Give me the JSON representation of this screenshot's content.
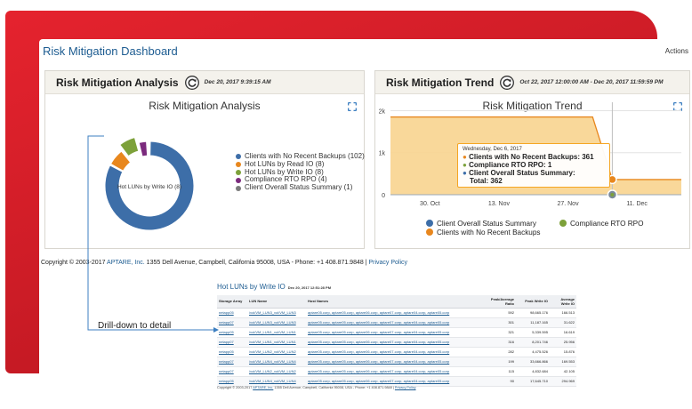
{
  "header": {
    "title": "Risk Mitigation Dashboard",
    "actions": "Actions"
  },
  "analysis_panel": {
    "title": "Risk Mitigation Analysis",
    "date": "Dec 20, 2017 9:39:15 AM",
    "chart_title": "Risk Mitigation Analysis",
    "donut_label": "Hot LUNs by Write IO (8)",
    "expand_icon": "expand-icon",
    "refresh_icon": "refresh-icon"
  },
  "trend_panel": {
    "title": "Risk Mitigation Trend",
    "date": "Oct 22, 2017 12:00:00 AM - Dec 20, 2017 11:59:59 PM",
    "chart_title": "Risk Mitigation Trend",
    "tooltip": {
      "date": "Wednesday, Dec 6, 2017",
      "row1": "Clients with No Recent Backups: 361",
      "row2": "Compliance RTO RPO: 1",
      "row3": "Client Overall Status Summary:",
      "row4": "Total: 362"
    }
  },
  "chart_data": [
    {
      "type": "pie",
      "title": "Risk Mitigation Analysis",
      "labels": [
        "Clients with No Recent Backups",
        "Hot LUNs by Read IO",
        "Hot LUNs by Write IO",
        "Compliance RTO RPO",
        "Client Overall Status Summary"
      ],
      "legend": [
        "Clients with No Recent Backups (102)",
        "Hot LUNs by Read IO (8)",
        "Hot LUNs by Write IO (8)",
        "Compliance RTO RPO (4)",
        "Client Overall Status Summary (1)"
      ],
      "values": [
        102,
        8,
        8,
        4,
        1
      ],
      "colors": [
        "#3d6ea8",
        "#e8871e",
        "#7da13a",
        "#7b2a7d",
        "#7b7b7b"
      ],
      "legend_placement": "right"
    },
    {
      "type": "area",
      "title": "Risk Mitigation Trend",
      "x_ticks": [
        "30. Oct",
        "13. Nov",
        "27. Nov",
        "11. Dec"
      ],
      "y_ticks": [
        "0",
        "1k",
        "2k"
      ],
      "ylim": [
        0,
        2200
      ],
      "x": [
        "2017-10-22",
        "2017-10-30",
        "2017-11-13",
        "2017-11-27",
        "2017-12-02",
        "2017-12-06",
        "2017-12-11",
        "2017-12-20"
      ],
      "series": [
        {
          "name": "Client Overall Status Summary",
          "color": "#3d6ea8",
          "values": [
            null,
            null,
            null,
            null,
            null,
            null,
            null,
            null
          ]
        },
        {
          "name": "Compliance RTO RPO",
          "color": "#7da13a",
          "values": [
            1,
            1,
            1,
            1,
            1,
            1,
            1,
            1
          ]
        },
        {
          "name": "Clients with No Recent Backups",
          "color": "#e8871e",
          "values": [
            1850,
            1850,
            1850,
            1850,
            1850,
            361,
            361,
            361
          ]
        }
      ],
      "grid": true,
      "legend_placement": "bottom"
    }
  ],
  "footer": {
    "prefix": "Copyright © 2003-2017",
    "company": "APTARE, Inc.",
    "address": "1355 Dell Avenue, Campbell, California 95008, USA - Phone: +1 408.871.9848 |",
    "privacy": "Privacy Policy"
  },
  "drilldown": {
    "label": "Drill-down to detail",
    "title": "Hot LUNs by Write IO",
    "date": "Dec 20, 2017 12:51:28 PM",
    "columns": [
      "Storage Array",
      "LUN Name",
      "Host Names",
      "Peak/Average Ratio",
      "Peak Write IO",
      "Average Write IO"
    ],
    "hosts": "aptare05.corp, aptare05.corp, aptare06.corp, aptare07.corp, aptare04.corp, aptare05.corp",
    "rows": [
      {
        "array": "netapp05",
        "lun": "/vol/VM_LUN3_vol/VM_LUN3",
        "ratio": "592",
        "peak": "98,665.176",
        "avg": "166.513"
      },
      {
        "array": "netapp07",
        "lun": "/vol/VM_LUN3_vol/VM_LUN3",
        "ratio": "301",
        "peak": "11,187.165",
        "avg": "31.622"
      },
      {
        "array": "netapp05",
        "lun": "/vol/VM_LUN1_vol/VM_LUN1",
        "ratio": "321",
        "peak": "5,339.595",
        "avg": "16.619"
      },
      {
        "array": "netapp07",
        "lun": "/vol/VM_LUN1_vol/VM_LUN1",
        "ratio": "316",
        "peak": "8,201.746",
        "avg": "25.956"
      },
      {
        "array": "netapp05",
        "lun": "/vol/VM_LUN2_vol/VM_LUN2",
        "ratio": "282",
        "peak": "4,475.526",
        "avg": "15.876"
      },
      {
        "array": "netapp07",
        "lun": "/vol/VM_LUN4_vol/VM_LUN4",
        "ratio": "199",
        "peak": "33,666.866",
        "avg": "169.553"
      },
      {
        "array": "netapp07",
        "lun": "/vol/VM_LUN2_vol/VM_LUN2",
        "ratio": "115",
        "peak": "4,832.684",
        "avg": "42.105"
      },
      {
        "array": "netapp05",
        "lun": "/vol/VM_LUN4_vol/VM_LUN4",
        "ratio": "90",
        "peak": "17,645.710",
        "avg": "294.969"
      }
    ],
    "copyright_prefix": "Copyright © 2003-2017",
    "copyright_company": "APTARE, Inc.",
    "copyright_rest": "1355 Dell Avenue, Campbell, California 95008, USA - Phone: +1 408.871.9848 |",
    "copyright_privacy": "Privacy Policy"
  }
}
